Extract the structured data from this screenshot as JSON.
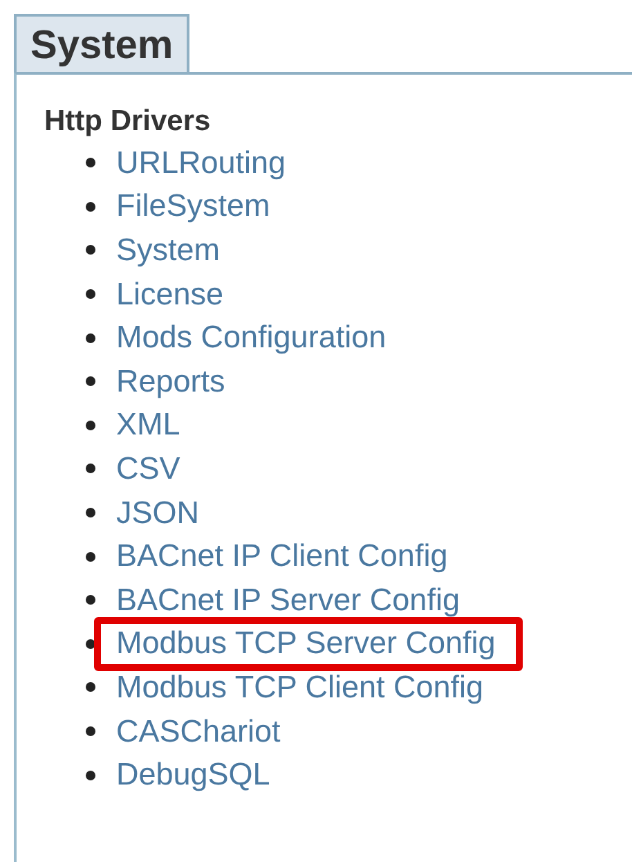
{
  "tab": {
    "label": "System",
    "selected": true
  },
  "section": {
    "heading": "Http Drivers",
    "items": [
      {
        "label": "URLRouting",
        "highlighted": false
      },
      {
        "label": "FileSystem",
        "highlighted": false
      },
      {
        "label": "System",
        "highlighted": false
      },
      {
        "label": "License",
        "highlighted": false
      },
      {
        "label": "Mods Configuration",
        "highlighted": false
      },
      {
        "label": "Reports",
        "highlighted": false
      },
      {
        "label": "XML",
        "highlighted": false
      },
      {
        "label": "CSV",
        "highlighted": false
      },
      {
        "label": "JSON",
        "highlighted": false
      },
      {
        "label": "BACnet IP Client Config",
        "highlighted": false
      },
      {
        "label": "BACnet IP Server Config",
        "highlighted": false
      },
      {
        "label": "Modbus TCP Server Config",
        "highlighted": true
      },
      {
        "label": "Modbus TCP Client Config",
        "highlighted": false
      },
      {
        "label": "CASChariot",
        "highlighted": false
      },
      {
        "label": "DebugSQL",
        "highlighted": false
      }
    ]
  }
}
